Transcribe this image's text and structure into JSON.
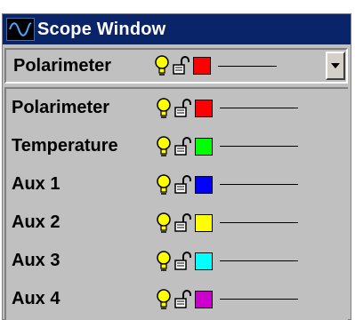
{
  "window": {
    "title": "Scope Window",
    "icon": "sine-wave-icon"
  },
  "selector": {
    "selected_label": "Polarimeter",
    "selected_color": "#ff0000",
    "button_icon": "dropdown-arrow-icon"
  },
  "channels": [
    {
      "label": "Polarimeter",
      "color": "#ff0000"
    },
    {
      "label": "Temperature",
      "color": "#00ff00"
    },
    {
      "label": "Aux 1",
      "color": "#0000ff"
    },
    {
      "label": "Aux 2",
      "color": "#ffff00"
    },
    {
      "label": "Aux 3",
      "color": "#00ffff"
    },
    {
      "label": "Aux 4",
      "color": "#cc00cc"
    }
  ],
  "icons": {
    "visibility": "lightbulb-icon",
    "lock": "padlock-open-icon"
  },
  "colors": {
    "titlebar": "#0a246a",
    "panel": "#c0c0c0"
  }
}
